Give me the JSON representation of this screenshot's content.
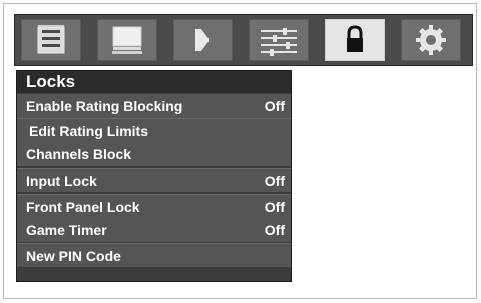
{
  "icons": [
    {
      "name": "picture-settings-icon"
    },
    {
      "name": "display-icon"
    },
    {
      "name": "audio-icon"
    },
    {
      "name": "equalizer-icon"
    },
    {
      "name": "lock-icon"
    },
    {
      "name": "gear-icon"
    }
  ],
  "menu": {
    "title": "Locks",
    "items": [
      {
        "label": "Enable Rating Blocking",
        "value": "Off"
      },
      {
        "label": "Edit Rating Limits",
        "value": ""
      },
      {
        "label": "Channels Block",
        "value": ""
      },
      {
        "label": "Input Lock",
        "value": "Off"
      },
      {
        "label": "Front Panel Lock",
        "value": "Off"
      },
      {
        "label": "Game Timer",
        "value": "Off"
      },
      {
        "label": "New PIN Code",
        "value": ""
      }
    ]
  },
  "colors": {
    "topbar": "#4a4a4a",
    "tab": "#6f6f6f",
    "tab_active": "#e5e5e5",
    "panel": "#3b3b3b",
    "row": "#555555",
    "text": "#ffffff"
  }
}
